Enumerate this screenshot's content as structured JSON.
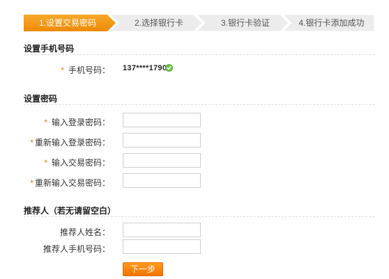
{
  "steps": [
    {
      "label": "1.设置交易密码",
      "active": true
    },
    {
      "label": "2.选择银行卡",
      "active": false
    },
    {
      "label": "3.银行卡验证",
      "active": false
    },
    {
      "label": "4.银行卡添加成功",
      "active": false
    }
  ],
  "colors": {
    "active_step": "#f3960f",
    "inactive_step": "#ececec",
    "required": "#f07800",
    "button": "#f58400"
  },
  "phone_section": {
    "title": "设置手机号码",
    "required_mark": "*",
    "label": "手机号码：",
    "value": "137****1790",
    "verified_icon": "check-circle-icon"
  },
  "password_section": {
    "title": "设置密码",
    "fields": [
      {
        "required_mark": "*",
        "label": "输入登录密码：",
        "value": ""
      },
      {
        "required_mark": "*",
        "label": "重新输入登录密码：",
        "value": ""
      },
      {
        "required_mark": "*",
        "label": "输入交易密码：",
        "value": ""
      },
      {
        "required_mark": "*",
        "label": "重新输入交易密码：",
        "value": ""
      }
    ]
  },
  "referrer_section": {
    "title": "推荐人（若无请留空白）",
    "fields": [
      {
        "label": "推荐人姓名：",
        "value": ""
      },
      {
        "label": "推荐人手机号码：",
        "value": ""
      }
    ]
  },
  "next_button": {
    "label": "下一步"
  }
}
